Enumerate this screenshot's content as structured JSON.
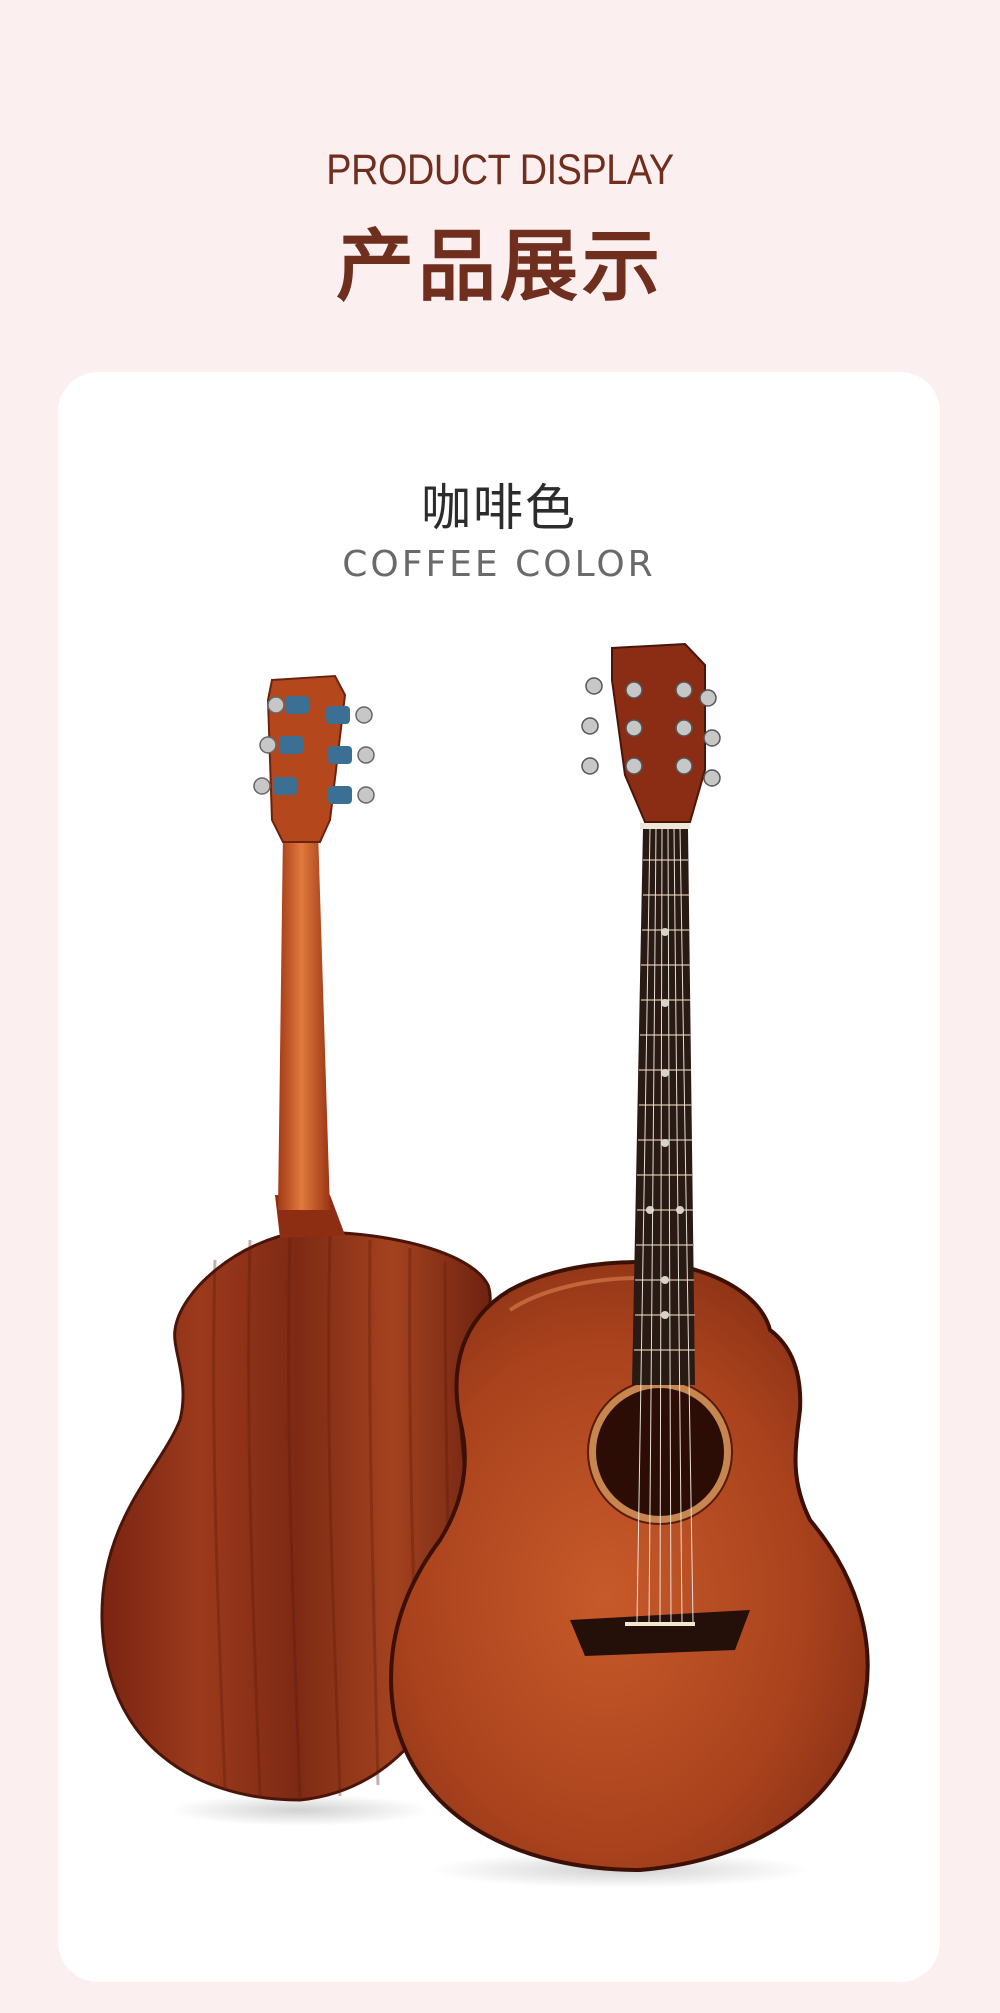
{
  "header": {
    "title_en": "PRODUCT DISPLAY",
    "title_zh": "产品展示"
  },
  "product": {
    "color_name_zh": "咖啡色",
    "color_name_en": "COFFEE COLOR"
  },
  "colors": {
    "page_bg": "#fbf0ef",
    "title": "#6f2e1e",
    "card_bg": "#ffffff",
    "wood": "#b34a24"
  },
  "images": {
    "guitar_back": "acoustic guitar, back view",
    "guitar_front": "acoustic guitar, front view"
  }
}
